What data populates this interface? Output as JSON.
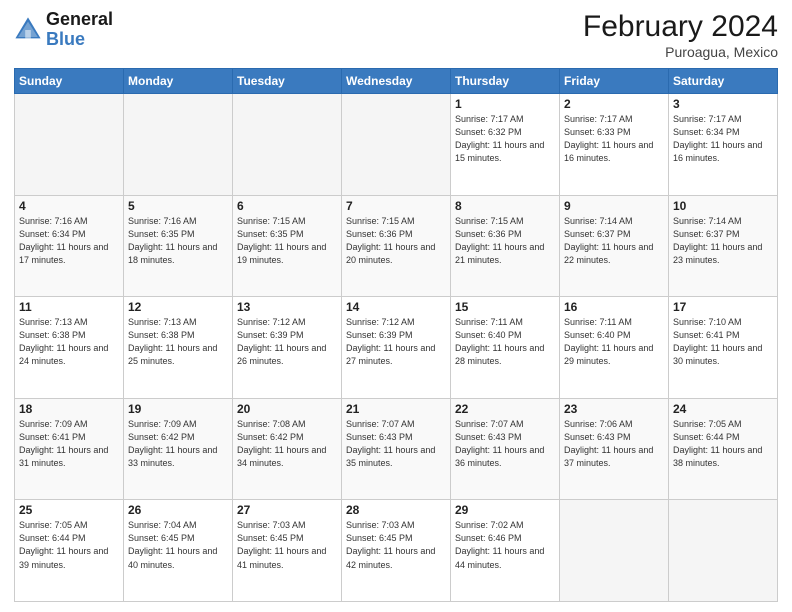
{
  "header": {
    "logo_line1": "General",
    "logo_line2": "Blue",
    "main_title": "February 2024",
    "subtitle": "Puroagua, Mexico"
  },
  "weekdays": [
    "Sunday",
    "Monday",
    "Tuesday",
    "Wednesday",
    "Thursday",
    "Friday",
    "Saturday"
  ],
  "weeks": [
    [
      {
        "num": "",
        "info": ""
      },
      {
        "num": "",
        "info": ""
      },
      {
        "num": "",
        "info": ""
      },
      {
        "num": "",
        "info": ""
      },
      {
        "num": "1",
        "info": "Sunrise: 7:17 AM\nSunset: 6:32 PM\nDaylight: 11 hours and 15 minutes."
      },
      {
        "num": "2",
        "info": "Sunrise: 7:17 AM\nSunset: 6:33 PM\nDaylight: 11 hours and 16 minutes."
      },
      {
        "num": "3",
        "info": "Sunrise: 7:17 AM\nSunset: 6:34 PM\nDaylight: 11 hours and 16 minutes."
      }
    ],
    [
      {
        "num": "4",
        "info": "Sunrise: 7:16 AM\nSunset: 6:34 PM\nDaylight: 11 hours and 17 minutes."
      },
      {
        "num": "5",
        "info": "Sunrise: 7:16 AM\nSunset: 6:35 PM\nDaylight: 11 hours and 18 minutes."
      },
      {
        "num": "6",
        "info": "Sunrise: 7:15 AM\nSunset: 6:35 PM\nDaylight: 11 hours and 19 minutes."
      },
      {
        "num": "7",
        "info": "Sunrise: 7:15 AM\nSunset: 6:36 PM\nDaylight: 11 hours and 20 minutes."
      },
      {
        "num": "8",
        "info": "Sunrise: 7:15 AM\nSunset: 6:36 PM\nDaylight: 11 hours and 21 minutes."
      },
      {
        "num": "9",
        "info": "Sunrise: 7:14 AM\nSunset: 6:37 PM\nDaylight: 11 hours and 22 minutes."
      },
      {
        "num": "10",
        "info": "Sunrise: 7:14 AM\nSunset: 6:37 PM\nDaylight: 11 hours and 23 minutes."
      }
    ],
    [
      {
        "num": "11",
        "info": "Sunrise: 7:13 AM\nSunset: 6:38 PM\nDaylight: 11 hours and 24 minutes."
      },
      {
        "num": "12",
        "info": "Sunrise: 7:13 AM\nSunset: 6:38 PM\nDaylight: 11 hours and 25 minutes."
      },
      {
        "num": "13",
        "info": "Sunrise: 7:12 AM\nSunset: 6:39 PM\nDaylight: 11 hours and 26 minutes."
      },
      {
        "num": "14",
        "info": "Sunrise: 7:12 AM\nSunset: 6:39 PM\nDaylight: 11 hours and 27 minutes."
      },
      {
        "num": "15",
        "info": "Sunrise: 7:11 AM\nSunset: 6:40 PM\nDaylight: 11 hours and 28 minutes."
      },
      {
        "num": "16",
        "info": "Sunrise: 7:11 AM\nSunset: 6:40 PM\nDaylight: 11 hours and 29 minutes."
      },
      {
        "num": "17",
        "info": "Sunrise: 7:10 AM\nSunset: 6:41 PM\nDaylight: 11 hours and 30 minutes."
      }
    ],
    [
      {
        "num": "18",
        "info": "Sunrise: 7:09 AM\nSunset: 6:41 PM\nDaylight: 11 hours and 31 minutes."
      },
      {
        "num": "19",
        "info": "Sunrise: 7:09 AM\nSunset: 6:42 PM\nDaylight: 11 hours and 33 minutes."
      },
      {
        "num": "20",
        "info": "Sunrise: 7:08 AM\nSunset: 6:42 PM\nDaylight: 11 hours and 34 minutes."
      },
      {
        "num": "21",
        "info": "Sunrise: 7:07 AM\nSunset: 6:43 PM\nDaylight: 11 hours and 35 minutes."
      },
      {
        "num": "22",
        "info": "Sunrise: 7:07 AM\nSunset: 6:43 PM\nDaylight: 11 hours and 36 minutes."
      },
      {
        "num": "23",
        "info": "Sunrise: 7:06 AM\nSunset: 6:43 PM\nDaylight: 11 hours and 37 minutes."
      },
      {
        "num": "24",
        "info": "Sunrise: 7:05 AM\nSunset: 6:44 PM\nDaylight: 11 hours and 38 minutes."
      }
    ],
    [
      {
        "num": "25",
        "info": "Sunrise: 7:05 AM\nSunset: 6:44 PM\nDaylight: 11 hours and 39 minutes."
      },
      {
        "num": "26",
        "info": "Sunrise: 7:04 AM\nSunset: 6:45 PM\nDaylight: 11 hours and 40 minutes."
      },
      {
        "num": "27",
        "info": "Sunrise: 7:03 AM\nSunset: 6:45 PM\nDaylight: 11 hours and 41 minutes."
      },
      {
        "num": "28",
        "info": "Sunrise: 7:03 AM\nSunset: 6:45 PM\nDaylight: 11 hours and 42 minutes."
      },
      {
        "num": "29",
        "info": "Sunrise: 7:02 AM\nSunset: 6:46 PM\nDaylight: 11 hours and 44 minutes."
      },
      {
        "num": "",
        "info": ""
      },
      {
        "num": "",
        "info": ""
      }
    ]
  ]
}
